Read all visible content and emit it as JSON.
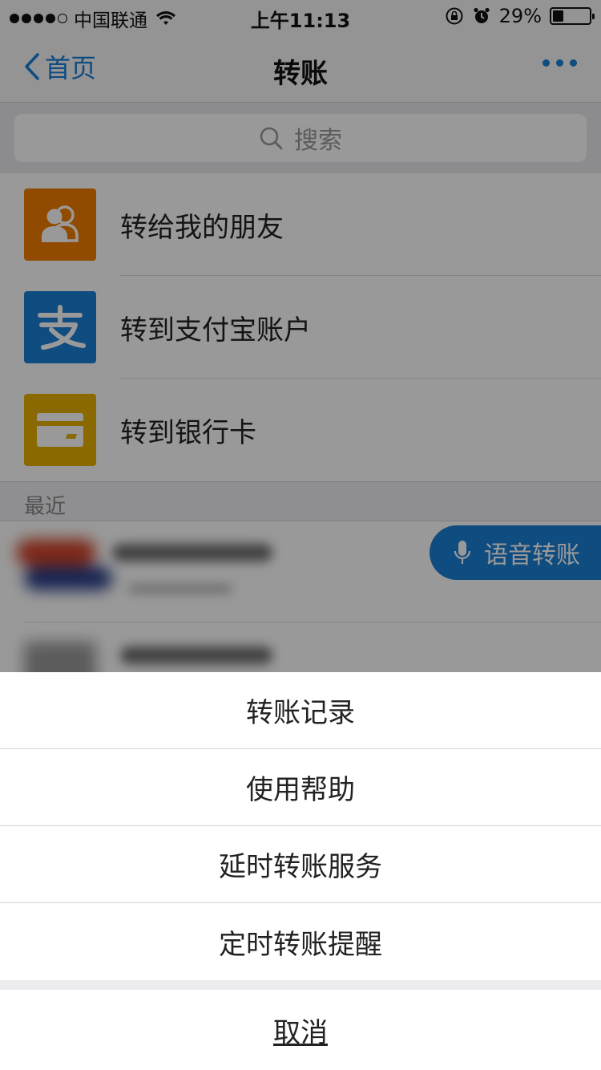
{
  "status_bar": {
    "carrier": "中国联通",
    "time": "上午11:13",
    "battery": "29%",
    "battery_level": 0.29
  },
  "nav": {
    "back_label": "首页",
    "title": "转账"
  },
  "search": {
    "placeholder": "搜索"
  },
  "menu": {
    "items": [
      {
        "label": "转给我的朋友",
        "icon": "friends-icon",
        "color": "#f07d00"
      },
      {
        "label": "转到支付宝账户",
        "icon": "alipay-icon",
        "color": "#1a7fd6"
      },
      {
        "label": "转到银行卡",
        "icon": "bank-card-icon",
        "color": "#e5b000"
      }
    ]
  },
  "recent": {
    "header": "最近"
  },
  "voice_transfer": {
    "label": "语音转账"
  },
  "action_sheet": {
    "options": [
      "转账记录",
      "使用帮助",
      "延时转账服务",
      "定时转账提醒"
    ],
    "cancel": "取消"
  },
  "colors": {
    "accent": "#1a7fd6"
  }
}
